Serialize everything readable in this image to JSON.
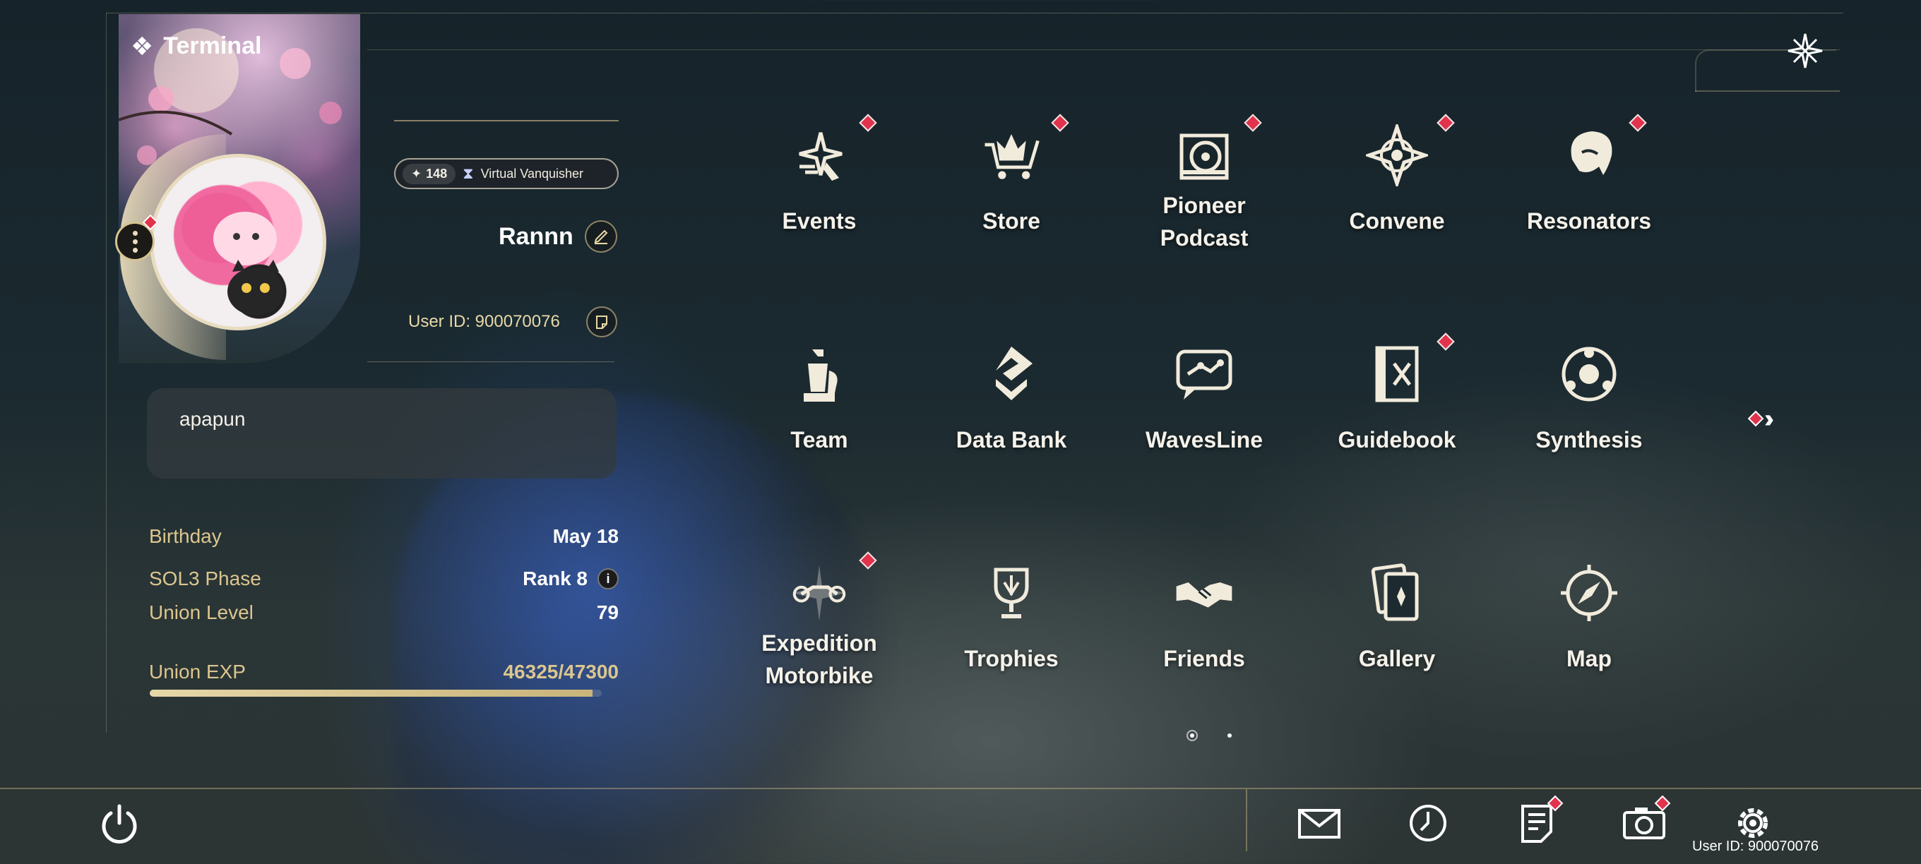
{
  "window": {
    "title": "Terminal"
  },
  "profile": {
    "level": "148",
    "title_badge": "Virtual Vanquisher",
    "name": "Rannn",
    "user_id": "User ID: 900070076",
    "signature": "apapun"
  },
  "stats": [
    {
      "label": "Birthday",
      "value": "May 18"
    },
    {
      "label": "SOL3 Phase",
      "value": "Rank 8"
    },
    {
      "label": "Union Level",
      "value": "79"
    },
    {
      "label": "Union EXP",
      "value": "46325/47300"
    }
  ],
  "union_exp_fraction": 0.979,
  "grid": {
    "items": [
      {
        "label": "Events",
        "icon": "events-icon",
        "badge": true
      },
      {
        "label": "Store",
        "icon": "store-cart-icon",
        "badge": true
      },
      {
        "label": "Pioneer Podcast",
        "icon": "podcast-record-icon",
        "badge": true
      },
      {
        "label": "Convene",
        "icon": "convene-star-icon",
        "badge": true
      },
      {
        "label": "Resonators",
        "icon": "resonator-portrait-icon",
        "badge": true
      },
      {
        "label": "Team",
        "icon": "chess-team-icon",
        "badge": false
      },
      {
        "label": "Data Bank",
        "icon": "data-bank-icon",
        "badge": false
      },
      {
        "label": "WavesLine",
        "icon": "chat-bubble-icon",
        "badge": false
      },
      {
        "label": "Guidebook",
        "icon": "guidebook-icon",
        "badge": true
      },
      {
        "label": "Synthesis",
        "icon": "synthesis-icon",
        "badge": false
      },
      {
        "label": "Expedition Motorbike",
        "icon": "motorbike-icon",
        "badge": true
      },
      {
        "label": "Trophies",
        "icon": "trophy-icon",
        "badge": false
      },
      {
        "label": "Friends",
        "icon": "handshake-icon",
        "badge": false
      },
      {
        "label": "Gallery",
        "icon": "gallery-cards-icon",
        "badge": false
      },
      {
        "label": "Map",
        "icon": "compass-icon",
        "badge": false
      }
    ]
  },
  "pager": {
    "current": 1,
    "total": 2
  },
  "footer": {
    "user_id": "User ID: 900070076"
  },
  "colors": {
    "accent_gold": "#dcc68e",
    "badge_red": "#e2334d"
  }
}
